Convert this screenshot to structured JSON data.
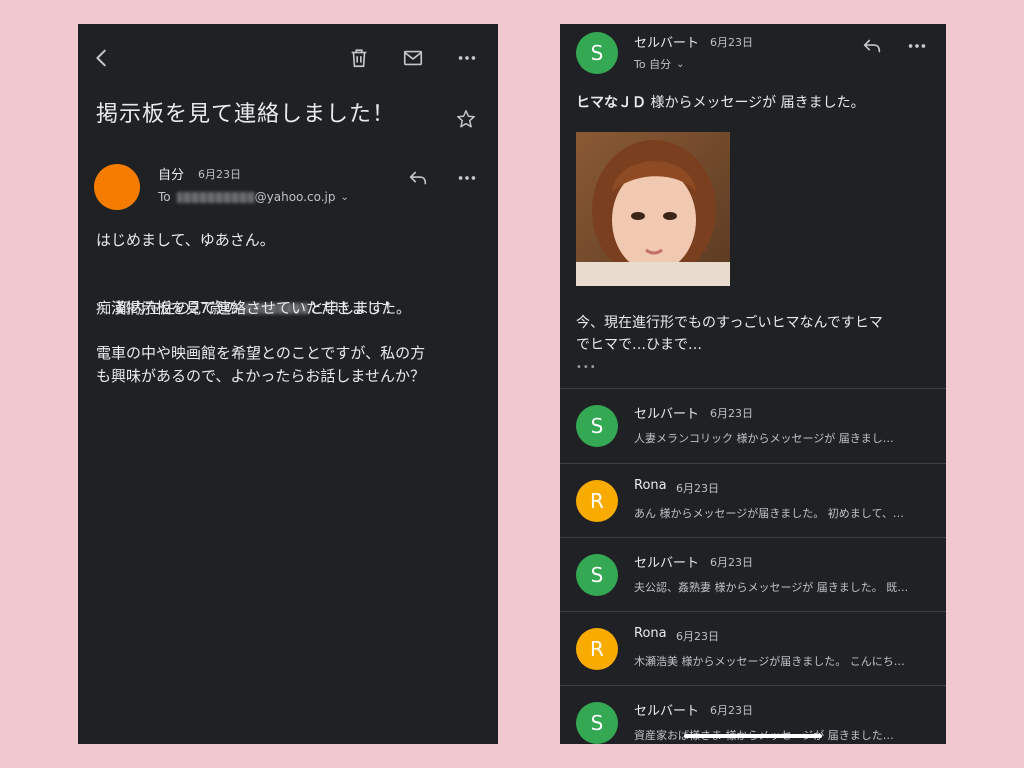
{
  "left_email": {
    "subject": "掲示板を見て連絡しました！",
    "sender": {
      "name": "自分",
      "date": "6月23日",
      "to_prefix": "To",
      "to_domain": "@yahoo.co.jp",
      "avatar_color": "#f57c00"
    },
    "body": {
      "p1": "はじめまして、ゆあさん。",
      "p2_line1_pre": "都内在住の27歳の",
      "p2_line1_post": "と申します！",
      "p2_line2": "痴漢掲示板を見て連絡させていただきました。",
      "p3": "電車の中や映画館を希望とのことですが、私の方\nも興味があるので、よかったらお話しませんか？"
    },
    "icons": [
      "back-arrow-icon",
      "trash-icon",
      "mail-icon",
      "more-icon",
      "star-icon",
      "reply-icon",
      "more-icon"
    ]
  },
  "right_email": {
    "header": {
      "name": "セルバート",
      "date": "6月23日",
      "to": "To 自分",
      "avatar_letter": "S",
      "avatar_color": "#34a853"
    },
    "headline_bold": "ヒマなＪＤ",
    "headline_rest": " 様からメッセージが 届きました。",
    "message": "今、現在進行形でものすっごいヒマなんですヒマ\nでヒマで…ひまで…",
    "ellipsis": "•••",
    "threads": [
      {
        "name": "セルバート",
        "date": "6月23日",
        "letter": "S",
        "color": "#34a853",
        "preview": "人妻メランコリック 様からメッセージが 届きまし…"
      },
      {
        "name": "Rona",
        "date": "6月23日",
        "letter": "R",
        "color": "#f9ab00",
        "preview": "あん 様からメッセージが届きました。 初めまして、…"
      },
      {
        "name": "セルバート",
        "date": "6月23日",
        "letter": "S",
        "color": "#34a853",
        "preview": "夫公認、姦熟妻 様からメッセージが 届きました。 既…"
      },
      {
        "name": "Rona",
        "date": "6月23日",
        "letter": "R",
        "color": "#f9ab00",
        "preview": "木瀬浩美 様からメッセージが届きました。 こんにち…"
      },
      {
        "name": "セルバート",
        "date": "6月23日",
        "letter": "S",
        "color": "#34a853",
        "preview": "資産家おば様さま 様からメッセージが 届きました…"
      }
    ]
  },
  "background_color": "#f0c8cf"
}
